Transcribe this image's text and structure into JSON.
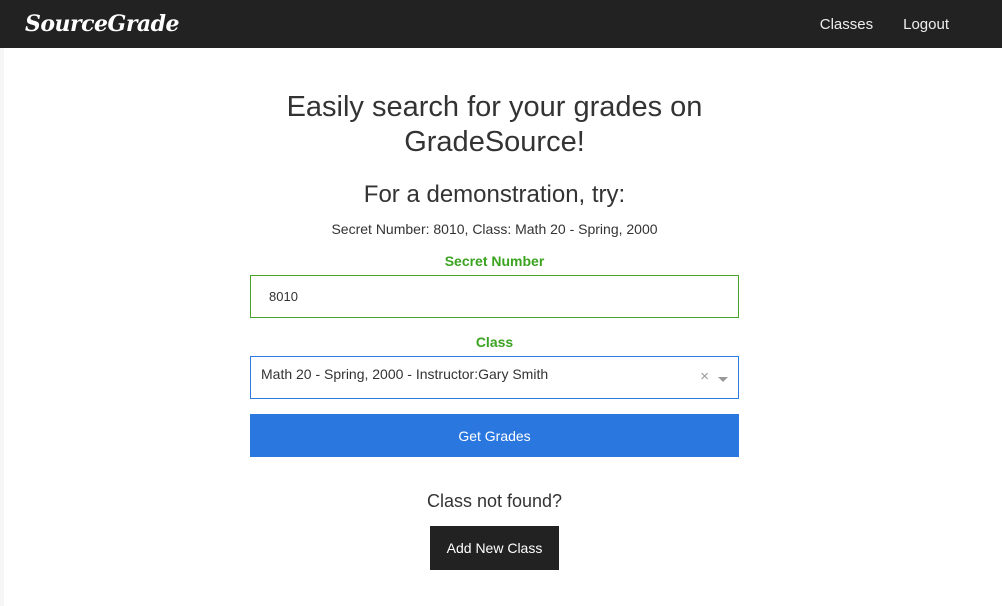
{
  "navbar": {
    "brand": "SourceGrade",
    "links": [
      {
        "label": "Classes"
      },
      {
        "label": "Logout"
      }
    ]
  },
  "main": {
    "headline": "Easily search for your grades on GradeSource!",
    "subheading": "For a demonstration, try:",
    "demo_hint": "Secret Number: 8010, Class: Math 20 - Spring, 2000",
    "secret_label": "Secret Number",
    "secret_value": "8010",
    "class_label": "Class",
    "class_selected": "Math 20 - Spring, 2000 - Instructor:Gary Smith",
    "clear_glyph": "×",
    "get_grades_label": "Get Grades",
    "not_found_text": "Class not found?",
    "add_class_label": "Add New Class"
  },
  "colors": {
    "navbar_bg": "#222222",
    "label_green": "#3aa320",
    "primary_blue": "#2a78df",
    "dark_button": "#222222"
  },
  "icons": {
    "select_clear": "clear-x-icon",
    "select_arrow": "caret-down-icon"
  }
}
